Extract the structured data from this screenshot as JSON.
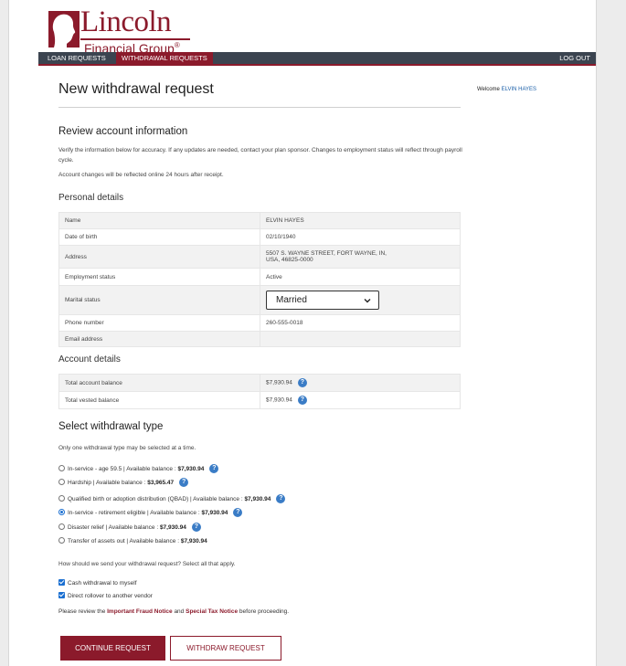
{
  "brand": {
    "name_line1": "Lincoln",
    "name_line2": "Financial Group",
    "reg": "®",
    "color": "#8b1a2b"
  },
  "nav": {
    "items": [
      {
        "label": "LOAN REQUESTS",
        "active": false
      },
      {
        "label": "WITHDRAWAL REQUESTS",
        "active": true
      }
    ],
    "logout": "Log Out"
  },
  "welcome": {
    "prefix": "Welcome",
    "name": "ELVIN HAYES"
  },
  "page_title": "New withdrawal request",
  "review": {
    "heading": "Review account information",
    "para1": "Verify the information below for accuracy. If any updates are needed, contact your plan sponsor. Changes to employment status will reflect through payroll cycle.",
    "para2": "Account changes will be reflected online 24 hours after receipt."
  },
  "personal": {
    "heading": "Personal details",
    "rows": [
      {
        "label": "Name",
        "value": "ELVIN HAYES"
      },
      {
        "label": "Date of birth",
        "value": "02/10/1940"
      },
      {
        "label": "Address",
        "value": "5507 S. WAYNE STREET, FORT WAYNE, IN,",
        "value2": "USA, 46825-0000"
      },
      {
        "label": "Employment status",
        "value": "Active"
      },
      {
        "label": "Marital status",
        "value": "Married"
      },
      {
        "label": "Phone number",
        "value": "260-555-0018"
      },
      {
        "label": "Email address",
        "value": ""
      }
    ]
  },
  "account": {
    "heading": "Account details",
    "rows": [
      {
        "label": "Total account balance",
        "value": "$7,930.94"
      },
      {
        "label": "Total vested balance",
        "value": "$7,930.94"
      }
    ]
  },
  "withdrawal": {
    "heading": "Select withdrawal type",
    "note": "Only one withdrawal type may be selected at a time.",
    "options": [
      {
        "text": "In-service - age 59.5 | Available balance : ",
        "amount": "$7,930.94",
        "help": true,
        "selected": false
      },
      {
        "text": "Hardship | Available balance : ",
        "amount": "$3,965.47",
        "help": true,
        "selected": false
      },
      {
        "text": "Qualified birth or adoption distribution (QBAD) | Available balance : ",
        "amount": "$7,930.94",
        "help": true,
        "selected": false
      },
      {
        "text": "In-service - retirement eligible | Available balance : ",
        "amount": "$7,930.94",
        "help": true,
        "selected": true
      },
      {
        "text": "Disaster relief | Available balance : ",
        "amount": "$7,930.94",
        "help": true,
        "selected": false
      },
      {
        "text": "Transfer of assets out | Available balance : ",
        "amount": "$7,930.94",
        "help": false,
        "selected": false
      }
    ],
    "send_question": "How should we send your withdrawal request? Select all that apply.",
    "send_options": [
      {
        "label": "Cash withdrawal to myself",
        "checked": true
      },
      {
        "label": "Direct rollover to another vendor",
        "checked": true
      }
    ]
  },
  "notice": {
    "prefix": "Please review the ",
    "link1": "Important Fraud Notice",
    "mid": " and ",
    "link2": "Special Tax Notice",
    "suffix": " before proceeding."
  },
  "buttons": {
    "continue": "CONTINUE REQUEST",
    "withdraw": "WITHDRAW REQUEST"
  }
}
